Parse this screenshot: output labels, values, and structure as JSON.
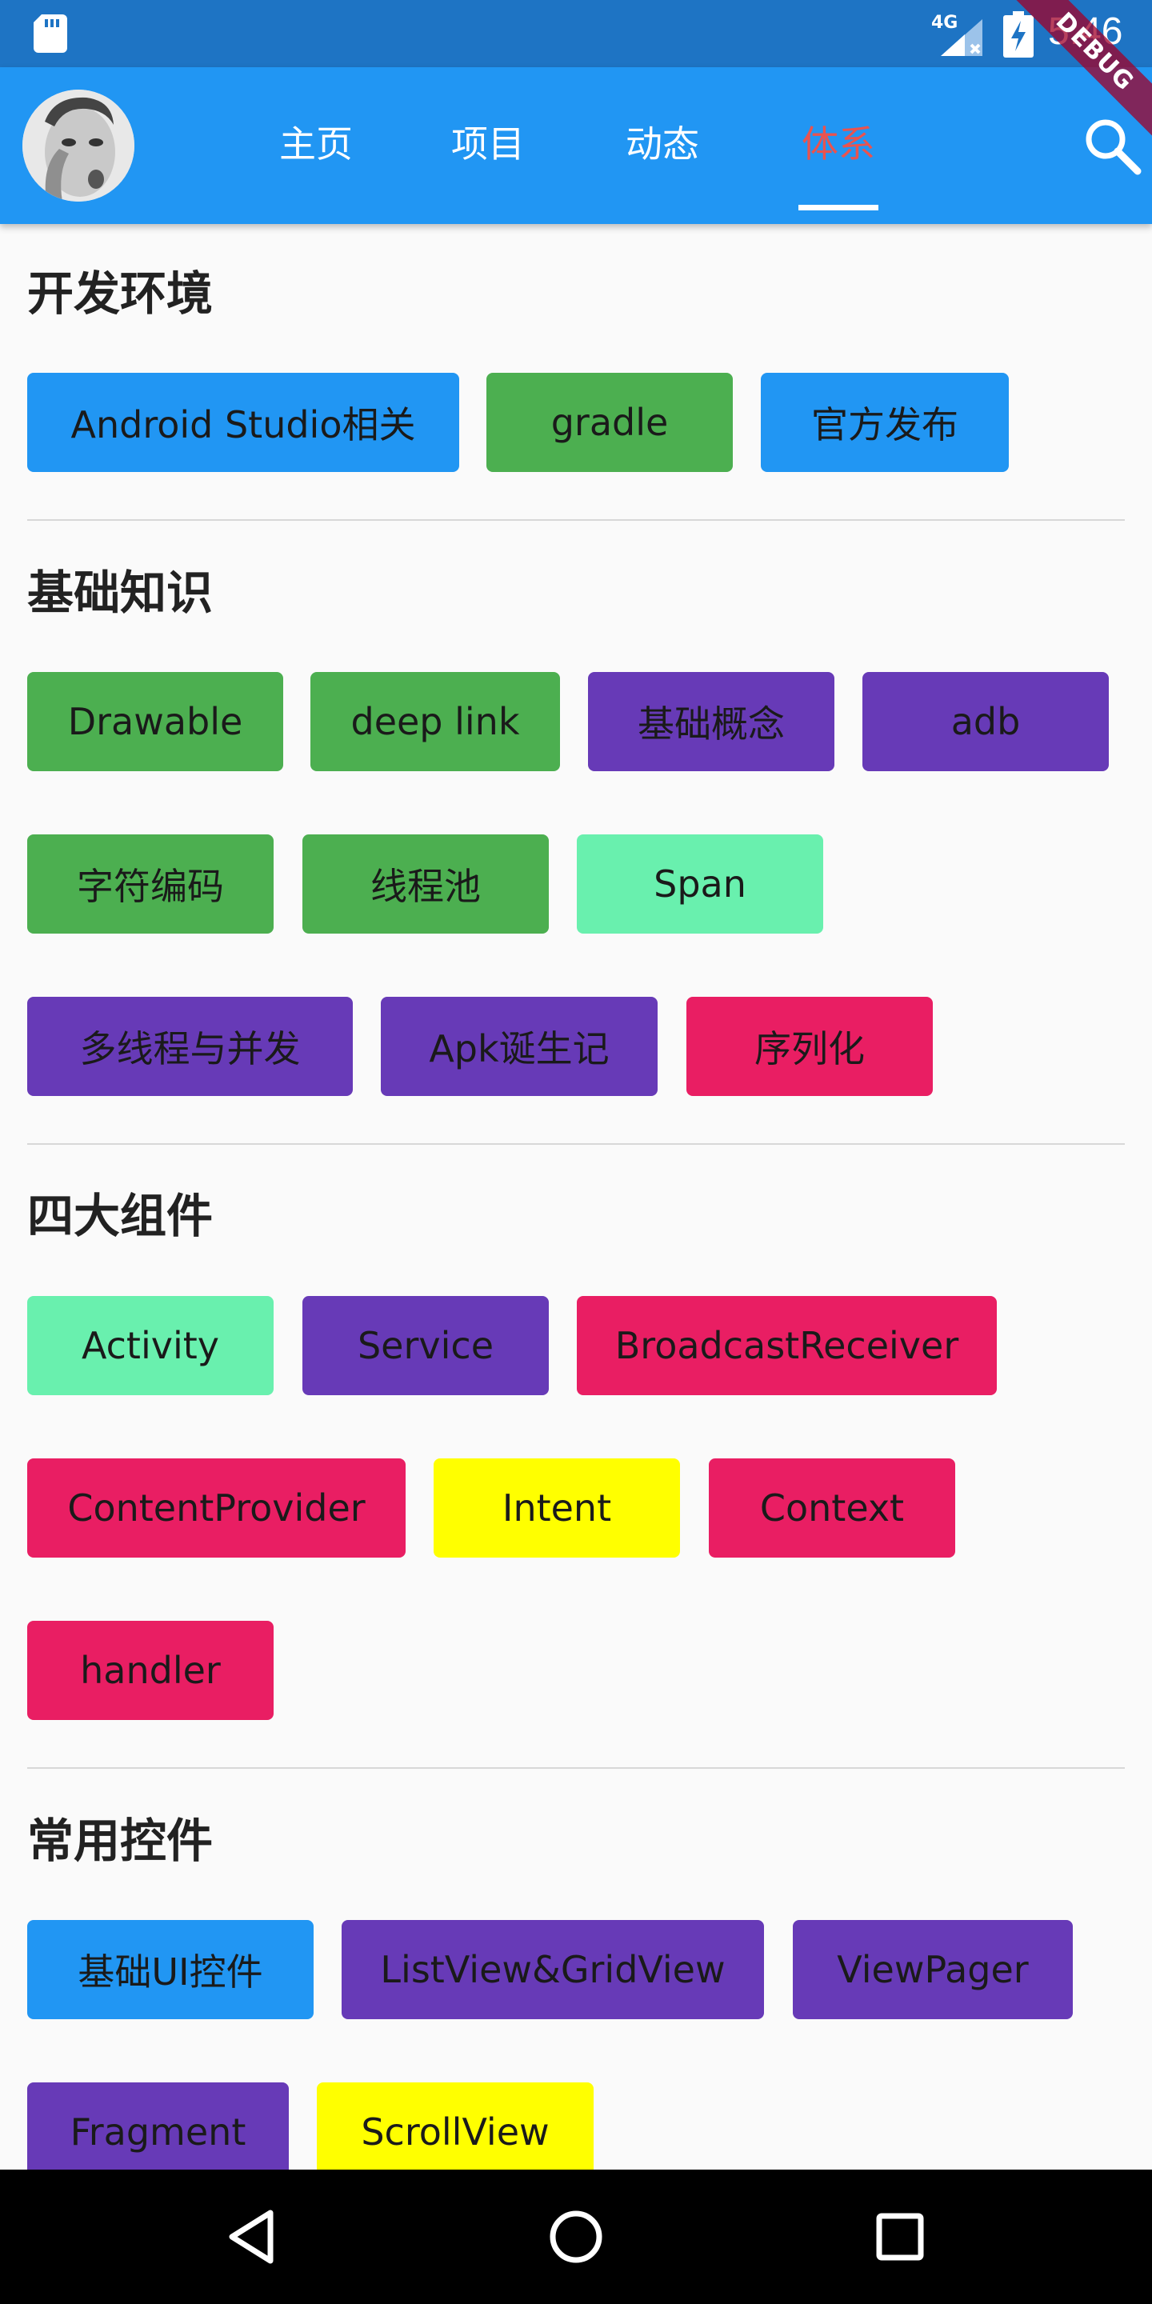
{
  "status_bar": {
    "time": "5:46",
    "network": "4G",
    "debug_banner": "DEBUG"
  },
  "app_bar": {
    "tabs": [
      "主页",
      "项目",
      "动态",
      "体系"
    ],
    "active_tab_index": 3,
    "active_color": "#e9534f"
  },
  "colors": {
    "blue": "#2196f3",
    "green": "#4caf50",
    "purple": "#673ab7",
    "mint": "#69f0ae",
    "pink": "#e91e63",
    "yellow": "#ffff00"
  },
  "sections": [
    {
      "title": "开发环境",
      "chips": [
        {
          "label": "Android Studio相关",
          "color": "blue"
        },
        {
          "label": "gradle",
          "color": "green"
        },
        {
          "label": "官方发布",
          "color": "blue"
        }
      ]
    },
    {
      "title": "基础知识",
      "chips": [
        {
          "label": "Drawable",
          "color": "green"
        },
        {
          "label": "deep link",
          "color": "green"
        },
        {
          "label": "基础概念",
          "color": "purple"
        },
        {
          "label": "adb",
          "color": "purple"
        },
        {
          "label": "字符编码",
          "color": "green"
        },
        {
          "label": "线程池",
          "color": "green"
        },
        {
          "label": "Span",
          "color": "mint"
        },
        {
          "label": "多线程与并发",
          "color": "purple"
        },
        {
          "label": "Apk诞生记",
          "color": "purple"
        },
        {
          "label": "序列化",
          "color": "pink"
        }
      ]
    },
    {
      "title": "四大组件",
      "chips": [
        {
          "label": "Activity",
          "color": "mint"
        },
        {
          "label": "Service",
          "color": "purple"
        },
        {
          "label": "BroadcastReceiver",
          "color": "pink"
        },
        {
          "label": "ContentProvider",
          "color": "pink"
        },
        {
          "label": "Intent",
          "color": "yellow"
        },
        {
          "label": "Context",
          "color": "pink"
        },
        {
          "label": "handler",
          "color": "pink"
        }
      ]
    },
    {
      "title": "常用控件",
      "chips": [
        {
          "label": "基础UI控件",
          "color": "blue"
        },
        {
          "label": "ListView&GridView",
          "color": "purple"
        },
        {
          "label": "ViewPager",
          "color": "purple"
        },
        {
          "label": "Fragment",
          "color": "purple"
        },
        {
          "label": "ScrollView",
          "color": "yellow"
        }
      ]
    }
  ]
}
